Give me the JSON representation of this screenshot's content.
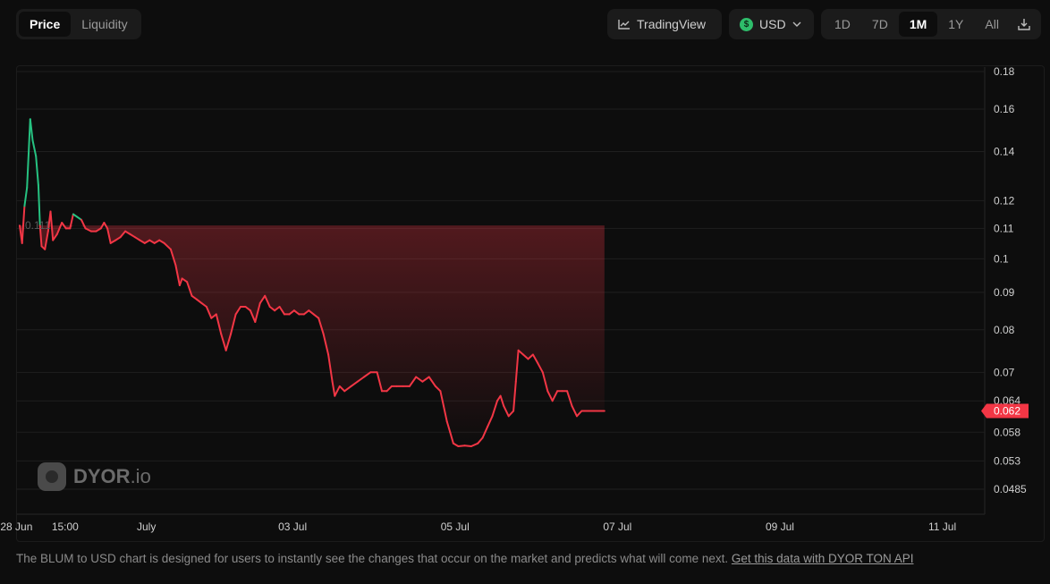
{
  "tabs": [
    {
      "label": "Price",
      "active": true
    },
    {
      "label": "Liquidity",
      "active": false
    }
  ],
  "toolbar": {
    "tradingview_label": "TradingView",
    "currency_label": "USD",
    "currency_symbol": "$",
    "ranges": [
      {
        "label": "1D",
        "active": false
      },
      {
        "label": "7D",
        "active": false
      },
      {
        "label": "1M",
        "active": true
      },
      {
        "label": "1Y",
        "active": false
      },
      {
        "label": "All",
        "active": false
      }
    ]
  },
  "watermark": {
    "brand": "DYOR",
    "suffix": ".io"
  },
  "footer": {
    "text": "The BLUM to USD chart is designed for users to instantly see the changes that occur on the market and predicts what will come next.",
    "link": "Get this data with DYOR TON API"
  },
  "colors": {
    "up": "#26c281",
    "down": "#f23645",
    "grid": "#1f1f1f",
    "axis_text": "#cfcfcf"
  },
  "chart_data": {
    "type": "line",
    "scale": "log",
    "y_ticks": [
      0.18,
      0.16,
      0.14,
      0.12,
      0.11,
      0.1,
      0.09,
      0.08,
      0.07,
      0.064,
      0.058,
      0.053,
      0.0485
    ],
    "y_tick_labels": [
      "0.18",
      "0.16",
      "0.14",
      "0.12",
      "0.11",
      "0.1",
      "0.09",
      "0.08",
      "0.07",
      "0.064",
      "0.058",
      "0.053",
      "0.0485"
    ],
    "x_ticks": [
      {
        "label": "28 Jun",
        "t": 0.6
      },
      {
        "label": "15:00",
        "t": 0.9
      },
      {
        "label": "July",
        "t": 1.4
      },
      {
        "label": "03 Jul",
        "t": 2.3
      },
      {
        "label": "05 Jul",
        "t": 3.3
      },
      {
        "label": "07 Jul",
        "t": 4.3
      },
      {
        "label": "09 Jul",
        "t": 5.3
      },
      {
        "label": "11 Jul",
        "t": 6.3
      }
    ],
    "reference_price": 0.111,
    "reference_label": "0.111",
    "current_price": 0.062,
    "current_label": "0.062",
    "t_range": [
      0.62,
      6.55
    ],
    "y_range": [
      0.0485,
      0.18
    ],
    "series": [
      {
        "t": 0.62,
        "y": 0.111
      },
      {
        "t": 0.635,
        "y": 0.105
      },
      {
        "t": 0.65,
        "y": 0.118
      },
      {
        "t": 0.665,
        "y": 0.125
      },
      {
        "t": 0.685,
        "y": 0.155
      },
      {
        "t": 0.7,
        "y": 0.145
      },
      {
        "t": 0.72,
        "y": 0.138
      },
      {
        "t": 0.735,
        "y": 0.126
      },
      {
        "t": 0.745,
        "y": 0.111
      },
      {
        "t": 0.755,
        "y": 0.104
      },
      {
        "t": 0.775,
        "y": 0.103
      },
      {
        "t": 0.795,
        "y": 0.109
      },
      {
        "t": 0.81,
        "y": 0.116
      },
      {
        "t": 0.825,
        "y": 0.106
      },
      {
        "t": 0.85,
        "y": 0.108
      },
      {
        "t": 0.88,
        "y": 0.112
      },
      {
        "t": 0.905,
        "y": 0.11
      },
      {
        "t": 0.93,
        "y": 0.11
      },
      {
        "t": 0.95,
        "y": 0.115
      },
      {
        "t": 0.975,
        "y": 0.114
      },
      {
        "t": 1.0,
        "y": 0.113
      },
      {
        "t": 1.025,
        "y": 0.11
      },
      {
        "t": 1.06,
        "y": 0.109
      },
      {
        "t": 1.09,
        "y": 0.109
      },
      {
        "t": 1.12,
        "y": 0.11
      },
      {
        "t": 1.14,
        "y": 0.112
      },
      {
        "t": 1.16,
        "y": 0.11
      },
      {
        "t": 1.18,
        "y": 0.105
      },
      {
        "t": 1.21,
        "y": 0.106
      },
      {
        "t": 1.24,
        "y": 0.107
      },
      {
        "t": 1.27,
        "y": 0.109
      },
      {
        "t": 1.3,
        "y": 0.108
      },
      {
        "t": 1.33,
        "y": 0.107
      },
      {
        "t": 1.36,
        "y": 0.106
      },
      {
        "t": 1.39,
        "y": 0.105
      },
      {
        "t": 1.42,
        "y": 0.106
      },
      {
        "t": 1.45,
        "y": 0.105
      },
      {
        "t": 1.48,
        "y": 0.106
      },
      {
        "t": 1.51,
        "y": 0.105
      },
      {
        "t": 1.55,
        "y": 0.103
      },
      {
        "t": 1.58,
        "y": 0.098
      },
      {
        "t": 1.605,
        "y": 0.092
      },
      {
        "t": 1.62,
        "y": 0.094
      },
      {
        "t": 1.65,
        "y": 0.093
      },
      {
        "t": 1.68,
        "y": 0.089
      },
      {
        "t": 1.71,
        "y": 0.088
      },
      {
        "t": 1.74,
        "y": 0.087
      },
      {
        "t": 1.77,
        "y": 0.086
      },
      {
        "t": 1.8,
        "y": 0.083
      },
      {
        "t": 1.83,
        "y": 0.084
      },
      {
        "t": 1.86,
        "y": 0.079
      },
      {
        "t": 1.89,
        "y": 0.075
      },
      {
        "t": 1.92,
        "y": 0.079
      },
      {
        "t": 1.95,
        "y": 0.084
      },
      {
        "t": 1.98,
        "y": 0.086
      },
      {
        "t": 2.01,
        "y": 0.086
      },
      {
        "t": 2.04,
        "y": 0.085
      },
      {
        "t": 2.07,
        "y": 0.082
      },
      {
        "t": 2.1,
        "y": 0.087
      },
      {
        "t": 2.13,
        "y": 0.089
      },
      {
        "t": 2.16,
        "y": 0.086
      },
      {
        "t": 2.19,
        "y": 0.085
      },
      {
        "t": 2.22,
        "y": 0.086
      },
      {
        "t": 2.25,
        "y": 0.084
      },
      {
        "t": 2.28,
        "y": 0.084
      },
      {
        "t": 2.31,
        "y": 0.085
      },
      {
        "t": 2.34,
        "y": 0.084
      },
      {
        "t": 2.37,
        "y": 0.084
      },
      {
        "t": 2.4,
        "y": 0.085
      },
      {
        "t": 2.43,
        "y": 0.084
      },
      {
        "t": 2.46,
        "y": 0.083
      },
      {
        "t": 2.49,
        "y": 0.079
      },
      {
        "t": 2.52,
        "y": 0.074
      },
      {
        "t": 2.545,
        "y": 0.068
      },
      {
        "t": 2.56,
        "y": 0.065
      },
      {
        "t": 2.59,
        "y": 0.067
      },
      {
        "t": 2.62,
        "y": 0.066
      },
      {
        "t": 2.66,
        "y": 0.067
      },
      {
        "t": 2.7,
        "y": 0.068
      },
      {
        "t": 2.74,
        "y": 0.069
      },
      {
        "t": 2.78,
        "y": 0.07
      },
      {
        "t": 2.82,
        "y": 0.07
      },
      {
        "t": 2.85,
        "y": 0.066
      },
      {
        "t": 2.88,
        "y": 0.066
      },
      {
        "t": 2.91,
        "y": 0.067
      },
      {
        "t": 2.94,
        "y": 0.067
      },
      {
        "t": 2.98,
        "y": 0.067
      },
      {
        "t": 3.02,
        "y": 0.067
      },
      {
        "t": 3.06,
        "y": 0.069
      },
      {
        "t": 3.1,
        "y": 0.068
      },
      {
        "t": 3.14,
        "y": 0.069
      },
      {
        "t": 3.18,
        "y": 0.067
      },
      {
        "t": 3.21,
        "y": 0.066
      },
      {
        "t": 3.23,
        "y": 0.063
      },
      {
        "t": 3.25,
        "y": 0.06
      },
      {
        "t": 3.27,
        "y": 0.058
      },
      {
        "t": 3.29,
        "y": 0.056
      },
      {
        "t": 3.32,
        "y": 0.0555
      },
      {
        "t": 3.36,
        "y": 0.0556
      },
      {
        "t": 3.4,
        "y": 0.0555
      },
      {
        "t": 3.44,
        "y": 0.056
      },
      {
        "t": 3.47,
        "y": 0.057
      },
      {
        "t": 3.5,
        "y": 0.059
      },
      {
        "t": 3.53,
        "y": 0.061
      },
      {
        "t": 3.56,
        "y": 0.064
      },
      {
        "t": 3.58,
        "y": 0.065
      },
      {
        "t": 3.6,
        "y": 0.063
      },
      {
        "t": 3.63,
        "y": 0.061
      },
      {
        "t": 3.66,
        "y": 0.062
      },
      {
        "t": 3.675,
        "y": 0.068
      },
      {
        "t": 3.69,
        "y": 0.075
      },
      {
        "t": 3.72,
        "y": 0.074
      },
      {
        "t": 3.75,
        "y": 0.073
      },
      {
        "t": 3.78,
        "y": 0.074
      },
      {
        "t": 3.81,
        "y": 0.072
      },
      {
        "t": 3.84,
        "y": 0.07
      },
      {
        "t": 3.87,
        "y": 0.066
      },
      {
        "t": 3.9,
        "y": 0.064
      },
      {
        "t": 3.93,
        "y": 0.066
      },
      {
        "t": 3.96,
        "y": 0.066
      },
      {
        "t": 3.99,
        "y": 0.066
      },
      {
        "t": 4.02,
        "y": 0.063
      },
      {
        "t": 4.05,
        "y": 0.061
      },
      {
        "t": 4.08,
        "y": 0.062
      },
      {
        "t": 4.11,
        "y": 0.062
      },
      {
        "t": 4.14,
        "y": 0.062
      },
      {
        "t": 4.17,
        "y": 0.062
      },
      {
        "t": 4.2,
        "y": 0.062
      },
      {
        "t": 4.22,
        "y": 0.062
      }
    ]
  }
}
